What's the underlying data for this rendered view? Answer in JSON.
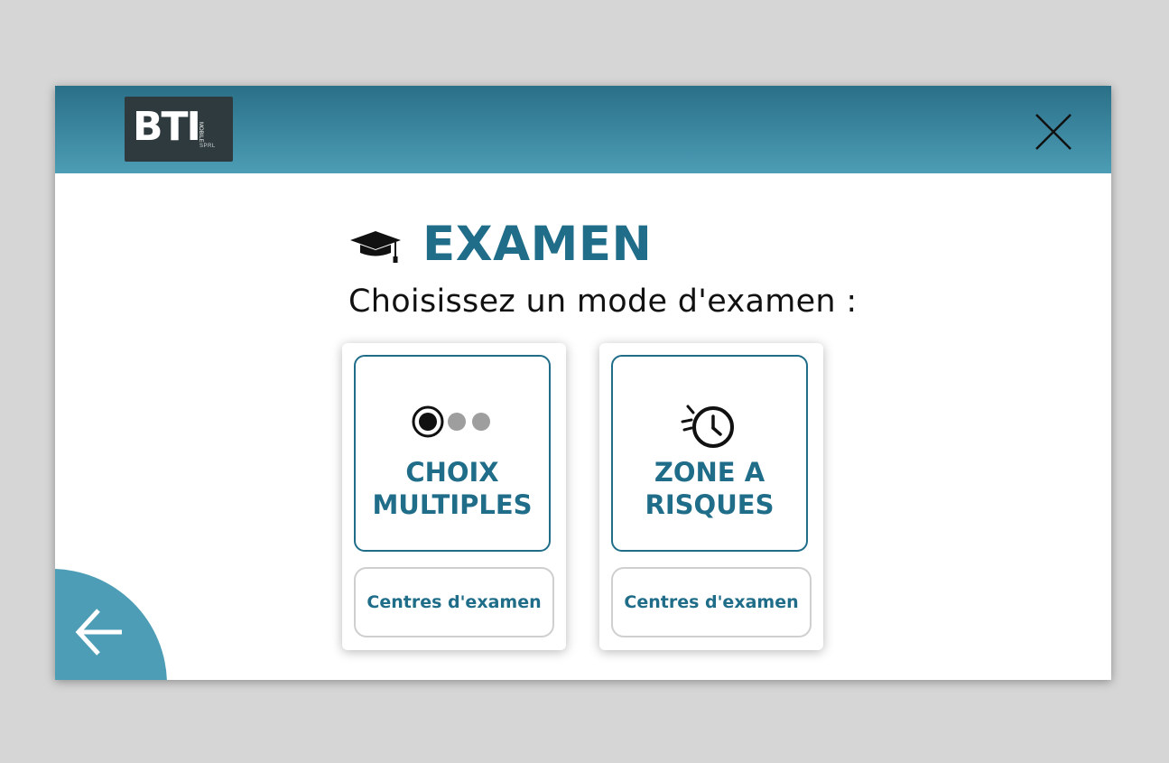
{
  "header": {
    "logo_text": "BTI",
    "logo_vertical": "MOBILE",
    "logo_sub": "SPRL",
    "close_icon": "close-icon"
  },
  "main": {
    "title": "EXAMEN",
    "title_icon": "graduation-cap-icon",
    "subtitle": "Choisissez un mode d'examen :",
    "modes": [
      {
        "icon": "radio-choice-icon",
        "label_line1": "CHOIX",
        "label_line2": "MULTIPLES",
        "centres_label": "Centres d'examen"
      },
      {
        "icon": "alarm-clock-icon",
        "label_line1": "ZONE A",
        "label_line2": "RISQUES",
        "centres_label": "Centres d'examen"
      }
    ]
  },
  "footer": {
    "back_icon": "arrow-left-icon"
  },
  "colors": {
    "accent": "#1f6d89",
    "header_top": "#2a6f88",
    "header_bottom": "#4c9db5",
    "back_button": "#4c9db5"
  }
}
